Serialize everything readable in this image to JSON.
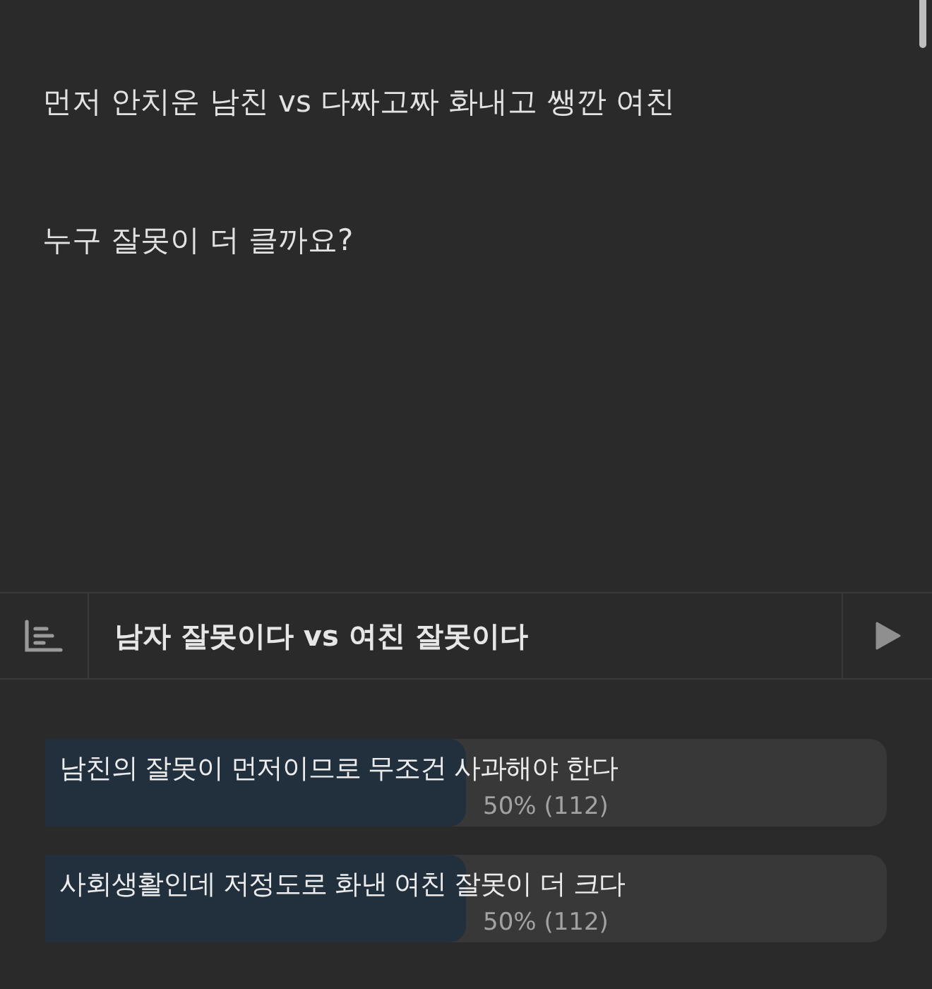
{
  "post": {
    "paragraphs": [
      "먼저 안치운 남친 vs 다짜고짜 화내고 쌩깐 여친",
      "누구 잘못이 더 클까요?"
    ]
  },
  "poll": {
    "title": "남자 잘못이다 vs 여친 잘못이다",
    "options": [
      {
        "label": "남친의 잘못이 먼저이므로 무조건 사과해야 한다",
        "level": 0.5,
        "result": "50% (112)"
      },
      {
        "label": "사회생활인데 저정도로 화낸 여친 잘못이 더 크다",
        "level": 0.5,
        "result": "50% (112)"
      }
    ]
  }
}
